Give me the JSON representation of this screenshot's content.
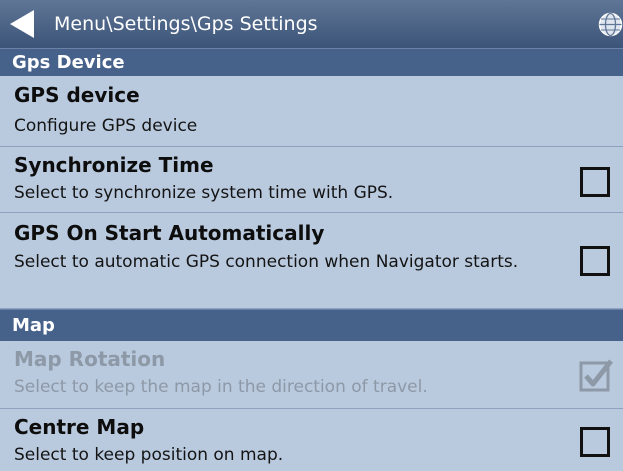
{
  "titlebar": {
    "title": "Menu\\Settings\\Gps Settings",
    "back_icon": "back-arrow-icon",
    "globe_icon": "globe-icon"
  },
  "sections": [
    {
      "header": "Gps Device",
      "items": [
        {
          "title": "GPS device",
          "description": "Configure GPS device",
          "checkbox": null,
          "enabled": true
        },
        {
          "title": "Synchronize Time",
          "description": "Select to synchronize system time with GPS.",
          "checkbox": false,
          "enabled": true
        },
        {
          "title": "GPS On Start Automatically",
          "description": "Select to automatic GPS connection when Navigator starts.",
          "checkbox": false,
          "enabled": true
        }
      ]
    },
    {
      "header": "Map",
      "items": [
        {
          "title": "Map Rotation",
          "description": "Select to keep the map in the direction of travel.",
          "checkbox": true,
          "enabled": false
        },
        {
          "title": "Centre Map",
          "description": "Select to keep position on map.",
          "checkbox": false,
          "enabled": true
        }
      ]
    }
  ],
  "colors": {
    "titlebar": "#4b6488",
    "section_header": "#47628a",
    "row_background": "#b9c9de",
    "disabled_text": "#8e99a8"
  }
}
